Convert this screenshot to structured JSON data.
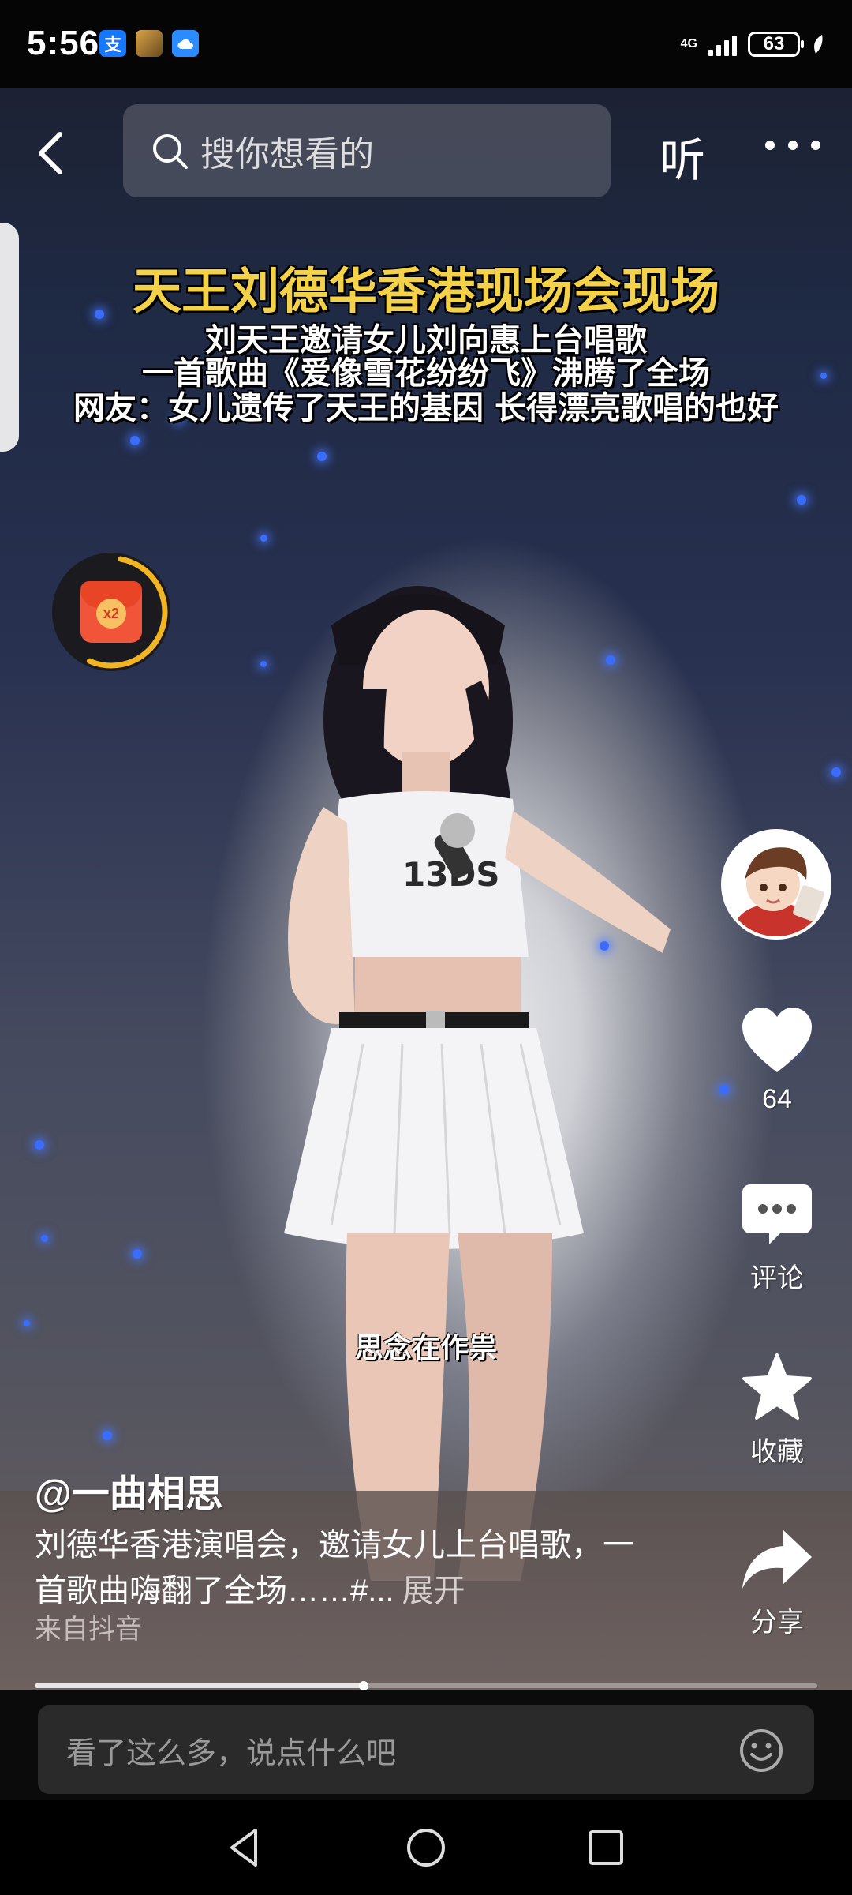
{
  "status_bar": {
    "time": "5:56",
    "app_icons": [
      "alipay-icon",
      "game-icon",
      "cloud-icon"
    ],
    "alipay_glyph": "支",
    "network": "4G",
    "battery": "63"
  },
  "top_nav": {
    "search_placeholder": "搜你想看的",
    "listen_label": "听"
  },
  "video": {
    "caption_title": "天王刘德华香港现场会现场",
    "caption_lines": [
      "刘天王邀请女儿刘向惠上台唱歌",
      "一首歌曲《爱像雪花纷纷飞》沸腾了全场",
      "网友：女儿遗传了天王的基因 长得漂亮歌唱的也好"
    ],
    "lyric": "思念在作祟"
  },
  "redpack": {
    "badge": "x2"
  },
  "actions": {
    "like_count": "64",
    "comment_label": "评论",
    "favorite_label": "收藏",
    "share_label": "分享"
  },
  "post": {
    "author": "@一曲相思",
    "description": "刘德华香港演唱会，邀请女儿上台唱歌，一首歌曲嗨翻了全场……#...",
    "expand_label": "展开",
    "source": "来自抖音",
    "progress": 0.42
  },
  "comment_bar": {
    "placeholder": "看了这么多，说点什么吧"
  },
  "colors": {
    "caption_yellow": "#f3d24a",
    "redpack_ring": "#f2b422",
    "redpack": "#f0553a"
  }
}
